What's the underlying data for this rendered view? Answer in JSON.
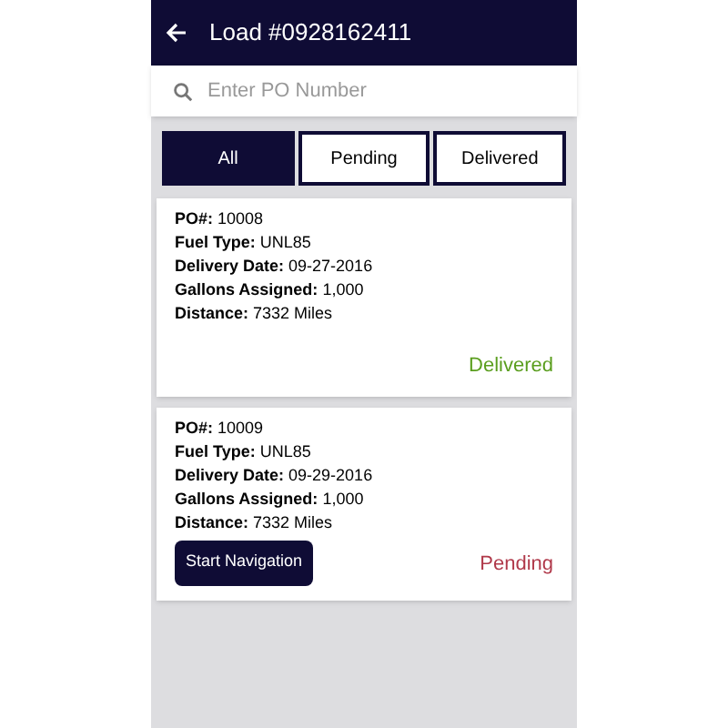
{
  "header": {
    "title": "Load #0928162411"
  },
  "search": {
    "placeholder": "Enter PO Number"
  },
  "tabs": [
    {
      "label": "All",
      "selected": true
    },
    {
      "label": "Pending",
      "selected": false
    },
    {
      "label": "Delivered",
      "selected": false
    }
  ],
  "orders": [
    {
      "lines": [
        "**PO#:** 10008",
        "**Fuel Type:** UNL85",
        "**Delivery Date:** 09-27-2016",
        "**Gallons Assigned:** 1,000",
        "**Distance:** 7332 Miles"
      ],
      "status": {
        "text": "Delivered",
        "kind": "delivered"
      }
    },
    {
      "lines": [
        "**PO#:** 10009",
        "**Fuel Type:** UNL85",
        "**Delivery Date:** 09-29-2016",
        "**Gallons Assigned:** 1,000",
        "**Distance:** 7332 Miles"
      ],
      "button": "Start Navigation",
      "status": {
        "text": "Pending",
        "kind": "pending"
      }
    }
  ]
}
